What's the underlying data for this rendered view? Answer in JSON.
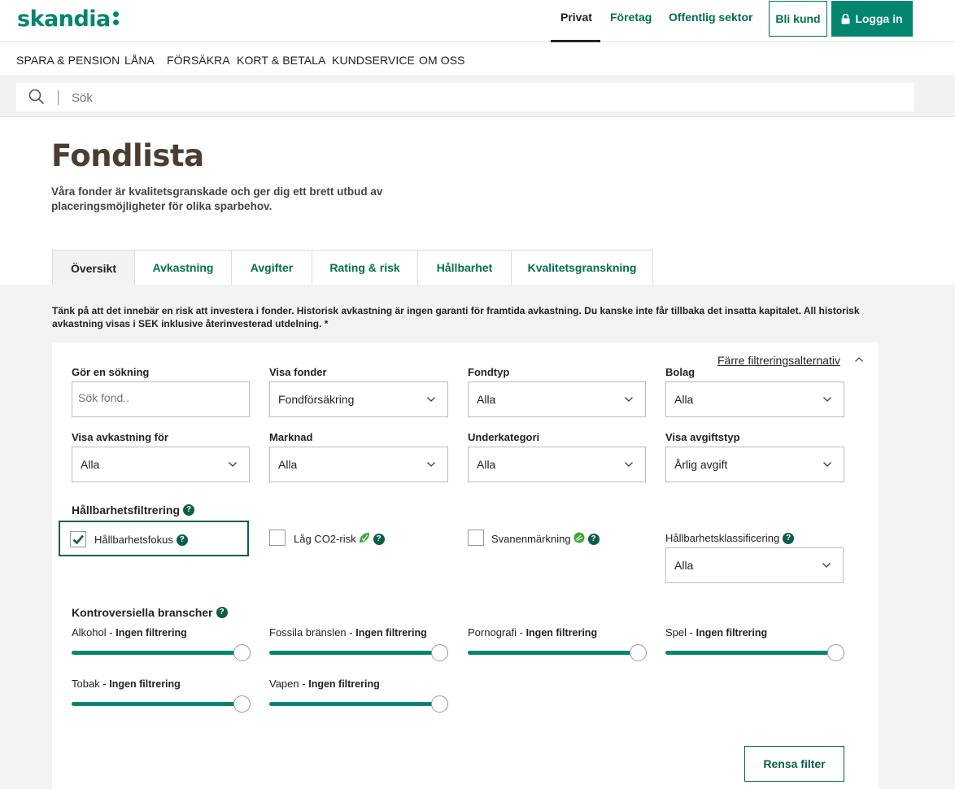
{
  "brand": {
    "logo": "skandia",
    "accent": "#00856f",
    "dark_green": "#0b5f4a"
  },
  "topnav": {
    "privat": "Privat",
    "foretag": "Företag",
    "offentlig": "Offentlig sektor",
    "bli_kund": "Bli kund",
    "logga_in": "Logga in"
  },
  "mainnav": [
    "SPARA & PENSION",
    "LÅNA",
    "FÖRSÄKRA",
    "KORT & BETALA",
    "KUNDSERVICE",
    "OM OSS"
  ],
  "search": {
    "placeholder": "Sök"
  },
  "page": {
    "title": "Fondlista",
    "intro": "Våra fonder är kvalitetsgranskade och ger dig ett brett utbud av placeringsmöjligheter för olika sparbehov."
  },
  "tabs": [
    "Översikt",
    "Avkastning",
    "Avgifter",
    "Rating & risk",
    "Hållbarhet",
    "Kvalitetsgranskning"
  ],
  "disclaimer": "Tänk på att det innebär en risk att investera i fonder. Historisk avkastning är ingen garanti för framtida avkastning. Du kanske inte får tillbaka det insatta kapitalet. All historisk avkastning visas i SEK inklusive återinvesterad utdelning. *",
  "filters": {
    "fewer_label": "Färre filtreringsalternativ",
    "search_label": "Gör en sökning",
    "search_placeholder": "Sök fond..",
    "visa_fonder": {
      "label": "Visa fonder",
      "value": "Fondförsäkring"
    },
    "fondtyp": {
      "label": "Fondtyp",
      "value": "Alla"
    },
    "bolag": {
      "label": "Bolag",
      "value": "Alla"
    },
    "visa_avkastning": {
      "label": "Visa avkastning för",
      "value": "Alla"
    },
    "marknad": {
      "label": "Marknad",
      "value": "Alla"
    },
    "underkategori": {
      "label": "Underkategori",
      "value": "Alla"
    },
    "avgiftstyp": {
      "label": "Visa avgiftstyp",
      "value": "Årlig avgift"
    },
    "sustainability_label": "Hållbarhetsfiltrering",
    "hallbarhetsfokus": {
      "label": "Hållbarhetsfokus",
      "checked": true
    },
    "lag_co2": {
      "label": "Låg CO2-risk",
      "checked": false
    },
    "svanen": {
      "label": "Svanenmärkning",
      "checked": false
    },
    "klassificering": {
      "label": "Hållbarhetsklassificering",
      "value": "Alla"
    },
    "controversial_label": "Kontroversiella branscher",
    "sliders": [
      {
        "name": "Alkohol",
        "status": "Ingen filtrering",
        "level": 1.0
      },
      {
        "name": "Fossila bränslen",
        "status": "Ingen filtrering",
        "level": 1.0
      },
      {
        "name": "Pornografi",
        "status": "Ingen filtrering",
        "level": 1.0
      },
      {
        "name": "Spel",
        "status": "Ingen filtrering",
        "level": 1.0
      },
      {
        "name": "Tobak",
        "status": "Ingen filtrering",
        "level": 1.0
      },
      {
        "name": "Vapen",
        "status": "Ingen filtrering",
        "level": 1.0
      }
    ],
    "clear_label": "Rensa filter",
    "help_glyph": "?",
    "dash": "-"
  }
}
